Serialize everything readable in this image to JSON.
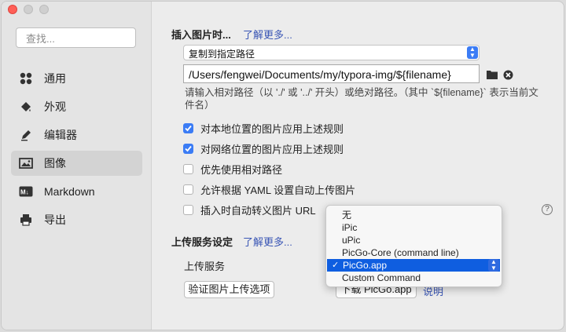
{
  "sidebar": {
    "search_placeholder": "查找...",
    "items": [
      {
        "label": "通用",
        "icon": "grid-icon"
      },
      {
        "label": "外观",
        "icon": "paint-bucket-icon"
      },
      {
        "label": "编辑器",
        "icon": "pencil-icon"
      },
      {
        "label": "图像",
        "icon": "image-icon",
        "active": true
      },
      {
        "label": "Markdown",
        "icon": "markdown-icon"
      },
      {
        "label": "导出",
        "icon": "printer-icon"
      }
    ]
  },
  "insert_image": {
    "title": "插入图片时...",
    "learn_more": "了解更多...",
    "action_select": "复制到指定路径",
    "path_value": "/Users/fengwei/Documents/my/typora-img/${filename}",
    "hint": "请输入相对路径（以 './' 或 '../' 开头）或绝对路径。（其中 `${filename}` 表示当前文件名）",
    "checkboxes": [
      {
        "label": "对本地位置的图片应用上述规则",
        "checked": true
      },
      {
        "label": "对网络位置的图片应用上述规则",
        "checked": true
      },
      {
        "label": "优先使用相对路径",
        "checked": false
      },
      {
        "label": "允许根据 YAML 设置自动上传图片",
        "checked": false
      },
      {
        "label": "插入时自动转义图片 URL",
        "checked": false
      }
    ],
    "help": "?"
  },
  "upload": {
    "title": "上传服务设定",
    "learn_more": "了解更多...",
    "service_label": "上传服务",
    "verify_button": "验证图片上传选项",
    "download_button": "下载 PicGo.app",
    "explain_link": "说明",
    "options": [
      "无",
      "iPic",
      "uPic",
      "PicGo-Core (command line)",
      "PicGo.app",
      "Custom Command"
    ],
    "selected": "PicGo.app"
  },
  "colors": {
    "accent": "#3b7cf5",
    "link": "#3a56b5",
    "selection": "#0f5ee0"
  }
}
